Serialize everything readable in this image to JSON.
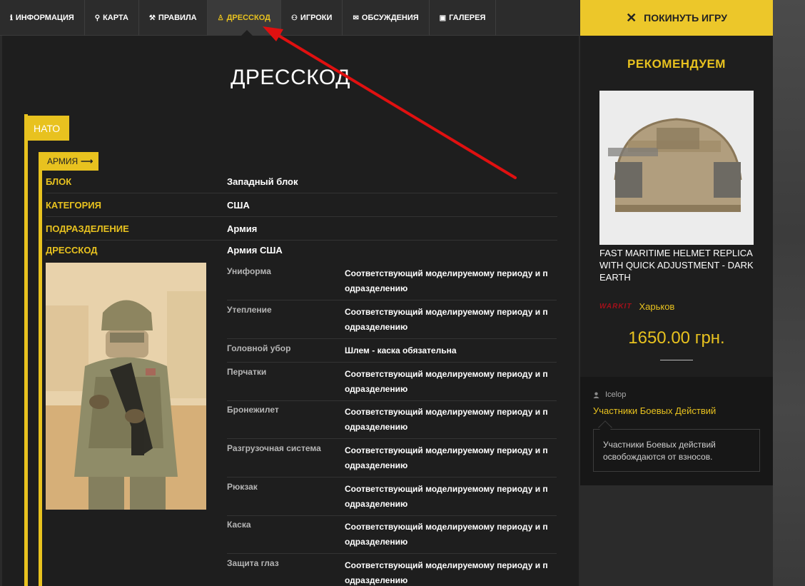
{
  "nav": {
    "tabs": [
      {
        "label": "ИНФОРМАЦИЯ",
        "icon": "info-icon",
        "glyph": "ℹ"
      },
      {
        "label": "КАРТА",
        "icon": "map-marker-icon",
        "glyph": "⚲"
      },
      {
        "label": "ПРАВИЛА",
        "icon": "gavel-icon",
        "glyph": "⚒"
      },
      {
        "label": "ДРЕССКОД",
        "icon": "male-figure-icon",
        "glyph": "♙",
        "active": true
      },
      {
        "label": "ИГРОКИ",
        "icon": "users-icon",
        "glyph": "⚇"
      },
      {
        "label": "ОБСУЖДЕНИЯ",
        "icon": "comments-icon",
        "glyph": "✉"
      },
      {
        "label": "ГАЛЕРЕЯ",
        "icon": "image-icon",
        "glyph": "▣"
      }
    ],
    "leave_label": "ПОКИНУТЬ ИГРУ"
  },
  "main": {
    "title": "ДРЕССКОД",
    "faction_tag": "НАТО",
    "branch_tag": "АРМИЯ",
    "info": [
      {
        "key": "БЛОК",
        "value": "Западный блок"
      },
      {
        "key": "КАТЕГОРИЯ",
        "value": "США"
      },
      {
        "key": "ПОДРАЗДЕЛЕНИЕ",
        "value": "Армия"
      }
    ],
    "dresscode_key": "ДРЕССКОД",
    "dresscode_value": "Армия США",
    "equipment": [
      {
        "item": "Униформа",
        "req": "Соответствующий моделируемому периоду и п\nодразделению"
      },
      {
        "item": "Утепление",
        "req": "Соответствующий моделируемому периоду и п\nодразделению"
      },
      {
        "item": "Головной убор",
        "req": "Шлем - каска обязательна"
      },
      {
        "item": "Перчатки",
        "req": "Соответствующий моделируемому периоду и п\nодразделению"
      },
      {
        "item": "Бронежилет",
        "req": "Соответствующий моделируемому периоду и п\nодразделению"
      },
      {
        "item": "Разгрузочная система",
        "req": "Соответствующий моделируемому периоду и п\nодразделению"
      },
      {
        "item": "Рюкзак",
        "req": "Соответствующий моделируемому периоду и п\nодразделению"
      },
      {
        "item": "Каска",
        "req": "Соответствующий моделируемому периоду и п\nодразделению"
      },
      {
        "item": "Защита глаз",
        "req": "Соответствующий моделируемому периоду и п\nодразделению"
      }
    ]
  },
  "sidebar": {
    "recommend_title": "РЕКОМЕНДУЕМ",
    "product_name": "FAST MARITIME HELMET REPLICA WITH QUICK ADJUSTMENT - DARK EARTH",
    "shop_logo": "WARKIT",
    "shop_city": "Харьков",
    "price": "1650.00 грн.",
    "comment": {
      "user": "Icelop",
      "topic": "Участники Боевых Действий",
      "text": "Участники Боевых действий освобождаются от взносов."
    }
  },
  "colors": {
    "accent": "#e8c21f",
    "panel": "#1e1e1e",
    "arrow": "#e01010"
  }
}
